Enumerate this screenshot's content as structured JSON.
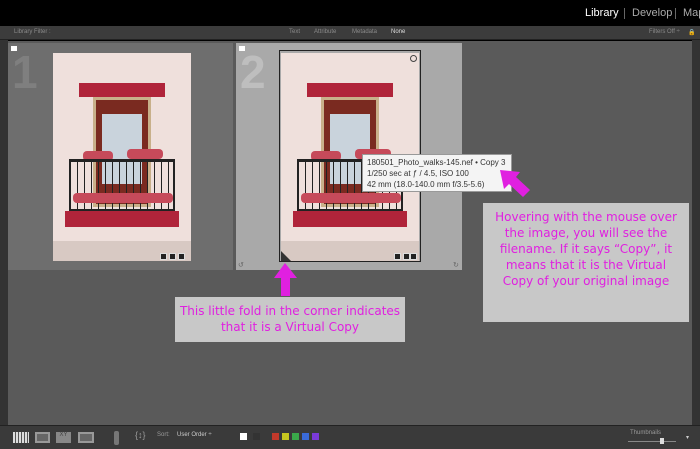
{
  "modules": [
    "Library",
    "Develop",
    "Map"
  ],
  "filter": {
    "label": "Library Filter :",
    "options": [
      "Text",
      "Attribute",
      "Metadata",
      "None"
    ],
    "right": "Filters Off ÷"
  },
  "cells": [
    {
      "index": "1"
    },
    {
      "index": "2"
    }
  ],
  "tooltip": {
    "line1": "180501_Photo_walks-145.nef  •  Copy 3",
    "line2": "1/250 sec at ƒ / 4.5, ISO 100",
    "line3": "42 mm (18.0-140.0 mm f/3.5-5.6)"
  },
  "notes": {
    "fold": "This little fold in the corner indicates that it is a Virtual Copy",
    "hover": "Hovering with the mouse over the image, you will see the filename. If it says “Copy”, it means that it is the Virtual Copy of your original image"
  },
  "toolbar": {
    "sort_label": "Sort:",
    "sort_value": "User Order ÷",
    "thumbnails_label": "Thumbnails"
  },
  "colors": {
    "accent": "#e020e0",
    "labels": [
      "#c0392b",
      "#c8c820",
      "#3aa84a",
      "#3a6ad8",
      "#7a3ad8"
    ]
  }
}
